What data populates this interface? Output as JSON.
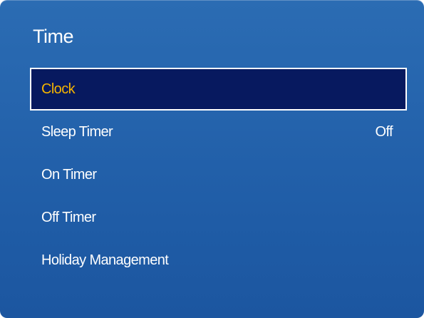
{
  "menu": {
    "title": "Time",
    "items": [
      {
        "label": "Clock",
        "value": "",
        "selected": true
      },
      {
        "label": "Sleep Timer",
        "value": "Off",
        "selected": false
      },
      {
        "label": "On Timer",
        "value": "",
        "selected": false
      },
      {
        "label": "Off Timer",
        "value": "",
        "selected": false
      },
      {
        "label": "Holiday Management",
        "value": "",
        "selected": false
      }
    ]
  },
  "colors": {
    "background_gradient_top": "#2b6cb3",
    "background_gradient_bottom": "#1c56a0",
    "selected_background": "#07195f",
    "selected_text": "#f5b400",
    "text": "#ffffff"
  }
}
